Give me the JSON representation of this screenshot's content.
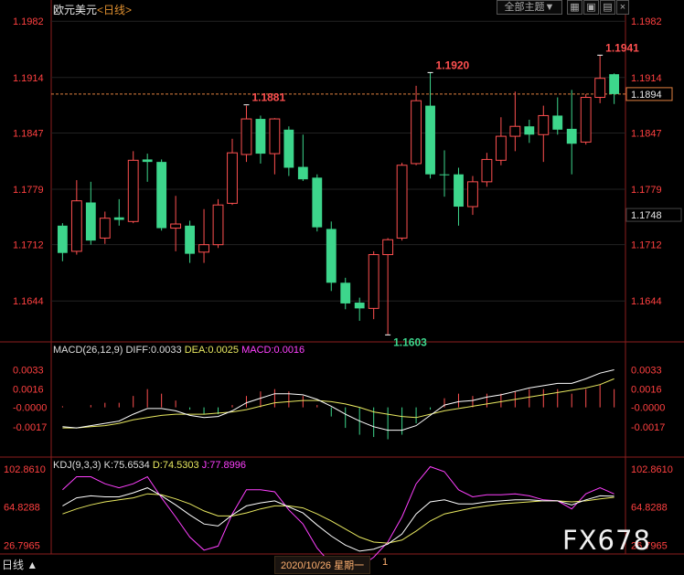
{
  "window": {
    "instrument": "欧元美元",
    "timeframe": "<日线>",
    "toolbar_button": "全部主题",
    "toolbar_arrow": "▼"
  },
  "icons": [
    "chart-mode-icon",
    "zoom-icon",
    "window-icon",
    "close-icon"
  ],
  "colors": {
    "up": "#ff5050",
    "down": "#3dd68c",
    "price_axis": "#ff4040",
    "diff": "#ffffff",
    "dea": "#e8e860",
    "macd_label": "#ff40ff",
    "k": "#ffffff",
    "d": "#e8e860",
    "j": "#ff40ff"
  },
  "status": {
    "period_label": "日线 ▲",
    "date_label": "2020/10/26 星期一",
    "date_suffix": "1"
  },
  "watermark": "FX678",
  "chart_data": [
    {
      "type": "candlestick",
      "ylim": [
        1.161,
        1.199
      ],
      "yticks": [
        "1.1982",
        "1.1914",
        "1.1847",
        "1.1779",
        "1.1712",
        "1.1644"
      ],
      "last_price": "1.1894",
      "marker_price": "1.1748",
      "annotations": [
        {
          "label": "1.1881",
          "index": 13,
          "value": 1.1881
        },
        {
          "label": "1.1603",
          "index": 23,
          "value": 1.1603
        },
        {
          "label": "1.1920",
          "index": 26,
          "value": 1.192
        },
        {
          "label": "1.1941",
          "index": 38,
          "value": 1.1941
        }
      ],
      "candles": [
        {
          "o": 1.1735,
          "h": 1.1738,
          "l": 1.1692,
          "c": 1.1702
        },
        {
          "o": 1.1704,
          "h": 1.179,
          "l": 1.17,
          "c": 1.1765
        },
        {
          "o": 1.1763,
          "h": 1.1788,
          "l": 1.1712,
          "c": 1.1717
        },
        {
          "o": 1.172,
          "h": 1.1752,
          "l": 1.1713,
          "c": 1.1744
        },
        {
          "o": 1.1745,
          "h": 1.1767,
          "l": 1.1735,
          "c": 1.1742
        },
        {
          "o": 1.174,
          "h": 1.1825,
          "l": 1.1738,
          "c": 1.1814
        },
        {
          "o": 1.1815,
          "h": 1.1822,
          "l": 1.1788,
          "c": 1.1812
        },
        {
          "o": 1.1812,
          "h": 1.1815,
          "l": 1.1729,
          "c": 1.1732
        },
        {
          "o": 1.1732,
          "h": 1.1771,
          "l": 1.1704,
          "c": 1.1737
        },
        {
          "o": 1.1735,
          "h": 1.1741,
          "l": 1.169,
          "c": 1.1701
        },
        {
          "o": 1.1703,
          "h": 1.1755,
          "l": 1.169,
          "c": 1.1712
        },
        {
          "o": 1.1712,
          "h": 1.1767,
          "l": 1.1708,
          "c": 1.176
        },
        {
          "o": 1.1762,
          "h": 1.184,
          "l": 1.176,
          "c": 1.1823
        },
        {
          "o": 1.1821,
          "h": 1.188,
          "l": 1.1812,
          "c": 1.1864
        },
        {
          "o": 1.1864,
          "h": 1.1868,
          "l": 1.181,
          "c": 1.1822
        },
        {
          "o": 1.1822,
          "h": 1.1865,
          "l": 1.1797,
          "c": 1.1864
        },
        {
          "o": 1.1851,
          "h": 1.1855,
          "l": 1.1795,
          "c": 1.1805
        },
        {
          "o": 1.1806,
          "h": 1.1845,
          "l": 1.1789,
          "c": 1.1791
        },
        {
          "o": 1.1793,
          "h": 1.1797,
          "l": 1.1728,
          "c": 1.1733
        },
        {
          "o": 1.1731,
          "h": 1.174,
          "l": 1.1656,
          "c": 1.1666
        },
        {
          "o": 1.1666,
          "h": 1.1672,
          "l": 1.1634,
          "c": 1.1641
        },
        {
          "o": 1.1642,
          "h": 1.1648,
          "l": 1.162,
          "c": 1.1635
        },
        {
          "o": 1.1635,
          "h": 1.1704,
          "l": 1.1622,
          "c": 1.17
        },
        {
          "o": 1.17,
          "h": 1.172,
          "l": 1.1603,
          "c": 1.1718
        },
        {
          "o": 1.172,
          "h": 1.1811,
          "l": 1.1717,
          "c": 1.1808
        },
        {
          "o": 1.181,
          "h": 1.1904,
          "l": 1.1808,
          "c": 1.1886
        },
        {
          "o": 1.188,
          "h": 1.192,
          "l": 1.1792,
          "c": 1.1797
        },
        {
          "o": 1.1797,
          "h": 1.1826,
          "l": 1.177,
          "c": 1.1796
        },
        {
          "o": 1.1797,
          "h": 1.1805,
          "l": 1.1735,
          "c": 1.1758
        },
        {
          "o": 1.1758,
          "h": 1.1795,
          "l": 1.1748,
          "c": 1.1788
        },
        {
          "o": 1.1788,
          "h": 1.1823,
          "l": 1.1782,
          "c": 1.1815
        },
        {
          "o": 1.1814,
          "h": 1.1866,
          "l": 1.1808,
          "c": 1.1843
        },
        {
          "o": 1.1843,
          "h": 1.1897,
          "l": 1.1825,
          "c": 1.1855
        },
        {
          "o": 1.1855,
          "h": 1.1863,
          "l": 1.1835,
          "c": 1.1845
        },
        {
          "o": 1.1845,
          "h": 1.188,
          "l": 1.1812,
          "c": 1.1868
        },
        {
          "o": 1.1868,
          "h": 1.189,
          "l": 1.1845,
          "c": 1.1851
        },
        {
          "o": 1.1852,
          "h": 1.1899,
          "l": 1.1797,
          "c": 1.1834
        },
        {
          "o": 1.1836,
          "h": 1.1894,
          "l": 1.1833,
          "c": 1.189
        },
        {
          "o": 1.189,
          "h": 1.1941,
          "l": 1.1883,
          "c": 1.1913
        },
        {
          "o": 1.1918,
          "h": 1.1919,
          "l": 1.1882,
          "c": 1.1894
        }
      ]
    },
    {
      "type": "macd",
      "title": "MACD(26,12,9)",
      "labels": {
        "diff": "DIFF:0.0033",
        "dea": "DEA:0.0025",
        "macd": "MACD:0.0016"
      },
      "ylim": [
        -0.0042,
        0.0043
      ],
      "yticks": [
        "0.0033",
        "0.0016",
        "-0.0000",
        "-0.0017"
      ],
      "diff": [
        -0.0017,
        -0.0018,
        -0.0016,
        -0.0014,
        -0.0012,
        -0.0006,
        -0.0001,
        -0.0001,
        -0.0003,
        -0.0007,
        -0.0009,
        -0.0008,
        -0.0003,
        0.0004,
        0.0008,
        0.0012,
        0.0012,
        0.0011,
        0.0007,
        0.0001,
        -0.0006,
        -0.0012,
        -0.0017,
        -0.002,
        -0.002,
        -0.0016,
        -0.0007,
        0.0002,
        0.0005,
        0.0006,
        0.0009,
        0.0011,
        0.0014,
        0.0017,
        0.0019,
        0.0021,
        0.0021,
        0.0025,
        0.003,
        0.0033
      ],
      "dea": [
        -0.0018,
        -0.0018,
        -0.0017,
        -0.0016,
        -0.0014,
        -0.0011,
        -0.0009,
        -0.0007,
        -0.0006,
        -0.0006,
        -0.0006,
        -0.0005,
        -0.0004,
        -0.0002,
        0.0001,
        0.0004,
        0.0005,
        0.0006,
        0.0006,
        0.0005,
        0.0003,
        0.0,
        -0.0004,
        -0.0006,
        -0.0008,
        -0.0009,
        -0.0006,
        -0.0003,
        -0.0001,
        0.0001,
        0.0003,
        0.0005,
        0.0007,
        0.0009,
        0.0011,
        0.0013,
        0.0015,
        0.0017,
        0.002,
        0.0025
      ],
      "macd": [
        0.0001,
        0.0,
        0.0002,
        0.0004,
        0.0004,
        0.001,
        0.0016,
        0.0012,
        0.0006,
        -0.0002,
        -0.0006,
        -0.0006,
        0.0002,
        0.001,
        0.0014,
        0.0016,
        0.0014,
        0.001,
        0.0002,
        -0.0008,
        -0.0018,
        -0.0024,
        -0.0026,
        -0.0028,
        -0.0024,
        -0.0014,
        -0.0002,
        0.0008,
        0.0012,
        0.001,
        0.0012,
        0.0012,
        0.0014,
        0.0016,
        0.0016,
        0.0016,
        0.0012,
        0.0016,
        0.002,
        0.0016
      ]
    },
    {
      "type": "kdj",
      "title": "KDJ(9,3,3)",
      "labels": {
        "k": "K:75.6534",
        "d": "D:74.5303",
        "j": "J:77.8996"
      },
      "ylim": [
        20,
        110
      ],
      "yticks": [
        "102.8610",
        "64.8288",
        "26.7965"
      ],
      "k": [
        66,
        74,
        76,
        75,
        75,
        79,
        84,
        76,
        67,
        57,
        48,
        46,
        57,
        66,
        69,
        71,
        65,
        59,
        47,
        36,
        27,
        21,
        23,
        28,
        38,
        58,
        70,
        72,
        68,
        68,
        70,
        71,
        72,
        72,
        71,
        71,
        67,
        72,
        76,
        75.65
      ],
      "d": [
        58,
        63,
        67,
        70,
        72,
        74,
        78,
        77,
        73,
        68,
        61,
        56,
        56,
        59,
        63,
        66,
        66,
        64,
        58,
        51,
        43,
        35,
        30,
        29,
        32,
        41,
        51,
        58,
        61,
        64,
        66,
        68,
        69,
        70,
        71,
        71,
        70,
        71,
        73,
        74.53
      ],
      "j": [
        82,
        95,
        95,
        88,
        84,
        88,
        95,
        74,
        55,
        35,
        22,
        26,
        58,
        82,
        82,
        80,
        62,
        48,
        24,
        8,
        -3,
        5,
        15,
        30,
        55,
        88,
        105,
        100,
        82,
        75,
        77,
        77,
        78,
        76,
        72,
        71,
        63,
        78,
        84,
        77.9
      ]
    }
  ]
}
